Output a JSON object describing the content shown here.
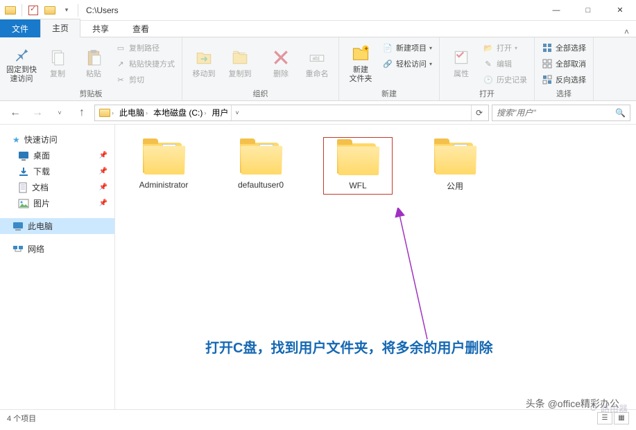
{
  "window": {
    "title": "C:\\Users",
    "controls": {
      "min": "—",
      "max": "□",
      "close": "✕"
    }
  },
  "tabs": {
    "file": "文件",
    "home": "主页",
    "share": "共享",
    "view": "查看"
  },
  "ribbon": {
    "clipboard": {
      "pin": "固定到快\n速访问",
      "copy": "复制",
      "paste": "粘贴",
      "copy_path": "复制路径",
      "paste_shortcut": "粘贴快捷方式",
      "cut": "剪切",
      "group": "剪贴板"
    },
    "organize": {
      "moveto": "移动到",
      "copyto": "复制到",
      "delete": "删除",
      "rename": "重命名",
      "group": "组织"
    },
    "new": {
      "newfolder": "新建\n文件夹",
      "newitem": "新建项目",
      "easyaccess": "轻松访问",
      "group": "新建"
    },
    "open": {
      "properties": "属性",
      "open": "打开",
      "edit": "编辑",
      "history": "历史记录",
      "group": "打开"
    },
    "select": {
      "selectall": "全部选择",
      "selectnone": "全部取消",
      "invert": "反向选择",
      "group": "选择"
    }
  },
  "address": {
    "segments": [
      "此电脑",
      "本地磁盘 (C:)",
      "用户"
    ]
  },
  "search": {
    "placeholder": "搜索\"用户\""
  },
  "sidebar": {
    "quickaccess": "快速访问",
    "desktop": "桌面",
    "downloads": "下载",
    "documents": "文档",
    "pictures": "图片",
    "thispc": "此电脑",
    "network": "网络"
  },
  "folders": [
    {
      "name": "Administrator"
    },
    {
      "name": "defaultuser0"
    },
    {
      "name": "WFL",
      "highlighted": true
    },
    {
      "name": "公用"
    }
  ],
  "annotation": "打开C盘，找到用户文件夹，将多余的用户删除",
  "status": {
    "items": "4 个项目"
  },
  "watermark": "头条 @office精彩办公",
  "watermark2": "路由器"
}
